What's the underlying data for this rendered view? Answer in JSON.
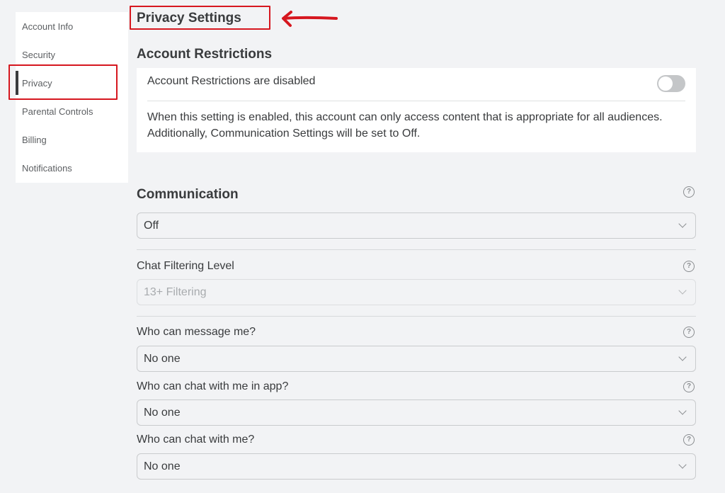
{
  "sidebar": {
    "items": [
      {
        "label": "Account Info"
      },
      {
        "label": "Security"
      },
      {
        "label": "Privacy",
        "active": true
      },
      {
        "label": "Parental Controls"
      },
      {
        "label": "Billing"
      },
      {
        "label": "Notifications"
      }
    ]
  },
  "page_title": "Privacy Settings",
  "account_restrictions": {
    "title": "Account Restrictions",
    "status_label": "Account Restrictions are disabled",
    "toggle_on": false,
    "description": "When this setting is enabled, this account can only access content that is appropriate for all audiences. Additionally, Communication Settings will be set to Off."
  },
  "communication": {
    "title": "Communication",
    "value": "Off"
  },
  "chat_filtering": {
    "label": "Chat Filtering Level",
    "value": "13+ Filtering",
    "disabled": true
  },
  "who_can_message": {
    "label": "Who can message me?",
    "value": "No one"
  },
  "who_can_chat_in_app": {
    "label": "Who can chat with me in app?",
    "value": "No one"
  },
  "who_can_chat": {
    "label": "Who can chat with me?",
    "value": "No one"
  },
  "annotation": {
    "color": "#d6171f"
  }
}
